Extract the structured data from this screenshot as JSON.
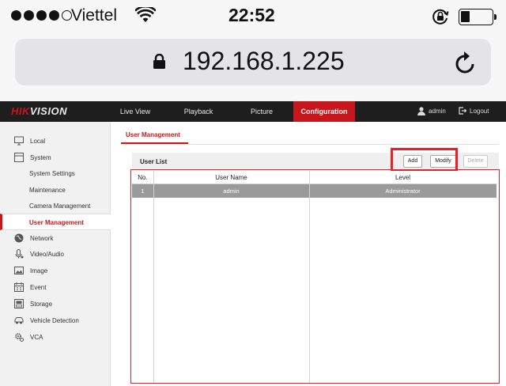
{
  "status_bar": {
    "carrier": "Viettel",
    "time": "22:52",
    "signal_bars_filled": 4,
    "signal_bars_total": 5
  },
  "browser": {
    "url": "192.168.1.225",
    "icons": {
      "lock": "lock-icon",
      "reload": "reload-icon"
    }
  },
  "topnav": {
    "logo_brand": "HIK",
    "logo_rest": "VISION",
    "items": [
      {
        "label": "Live View",
        "active": false
      },
      {
        "label": "Playback",
        "active": false
      },
      {
        "label": "Picture",
        "active": false
      },
      {
        "label": "Configuration",
        "active": true
      }
    ],
    "user": "admin",
    "logout": "Logout"
  },
  "sidebar": {
    "items": [
      {
        "label": "Local",
        "icon": "monitor-icon"
      },
      {
        "label": "System",
        "icon": "system-icon"
      },
      {
        "label": "System Settings",
        "sub": true
      },
      {
        "label": "Maintenance",
        "sub": true
      },
      {
        "label": "Camera Management",
        "sub": true
      },
      {
        "label": "User Management",
        "sub": true,
        "active": true
      },
      {
        "label": "Network",
        "icon": "globe-icon"
      },
      {
        "label": "Video/Audio",
        "icon": "microphone-icon"
      },
      {
        "label": "Image",
        "icon": "image-icon"
      },
      {
        "label": "Event",
        "icon": "calendar-icon"
      },
      {
        "label": "Storage",
        "icon": "storage-icon"
      },
      {
        "label": "Vehicle Detection",
        "icon": "vehicle-icon"
      },
      {
        "label": "VCA",
        "icon": "gear-icon"
      }
    ]
  },
  "main": {
    "tab_title": "User Management",
    "list_title": "User List",
    "buttons": {
      "add": "Add",
      "modify": "Modify",
      "delete": "Delete"
    },
    "table": {
      "columns": [
        "No.",
        "User Name",
        "Level"
      ],
      "rows": [
        [
          "1",
          "admin",
          "Administrator"
        ]
      ]
    }
  },
  "colors": {
    "accent": "#c8161d",
    "highlight_box": "#e4202b",
    "nav_bg": "#1e1e1e",
    "selected_row": "#9a9a9a"
  }
}
